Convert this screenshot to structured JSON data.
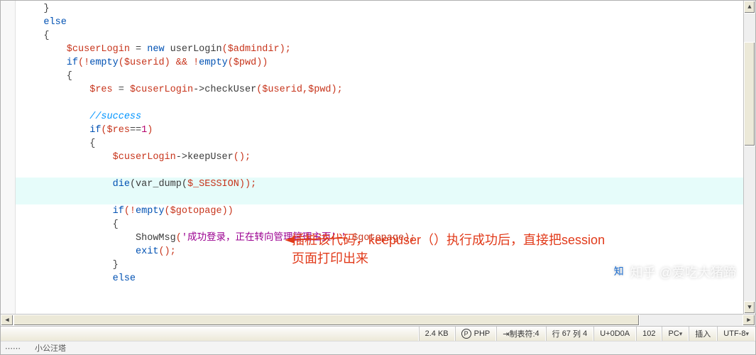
{
  "code": {
    "l01": "    }",
    "l02": "    else",
    "l03": "    {",
    "l04a": "        $cuserLogin",
    "l04b": " = ",
    "l04c": "new",
    "l04d": " userLogin",
    "l04e": "(",
    "l04f": "$admindir",
    "l04g": ");",
    "l05a": "        if",
    "l05b": "(!",
    "l05c": "empty",
    "l05d": "(",
    "l05e": "$userid",
    "l05f": ") && !",
    "l05g": "empty",
    "l05h": "(",
    "l05i": "$pwd",
    "l05j": "))",
    "l06": "        {",
    "l07a": "            $res",
    "l07b": " = ",
    "l07c": "$cuserLogin",
    "l07d": "->checkUser",
    "l07e": "(",
    "l07f": "$userid",
    "l07g": ",",
    "l07h": "$pwd",
    "l07i": ");",
    "l08": " ",
    "l09a": "            //success",
    "l10a": "            if",
    "l10b": "(",
    "l10c": "$res",
    "l10d": "==",
    "l10e": "1",
    "l10f": ")",
    "l11": "            {",
    "l12a": "                $cuserLogin",
    "l12b": "->keepUser",
    "l12c": "();",
    "l13": "                ",
    "l14a": "                die",
    "l14b": "(var_dump(",
    "l14c": "$_SESSION",
    "l14d": "));",
    "l15": "                ",
    "l16a": "                if",
    "l16b": "(!",
    "l16c": "empty",
    "l16d": "(",
    "l16e": "$gotopage",
    "l16f": "))",
    "l17": "                {",
    "l18a": "                    ShowMsg",
    "l18b": "(",
    "l18c": "'成功登录，正在转向管理管理主页！'",
    "l18d": ",",
    "l18e": "$gotopage",
    "l18f": ");",
    "l19a": "                    exit",
    "l19b": "();",
    "l20": "                }",
    "l21": "                else"
  },
  "annotation": {
    "line1": "插桩该代码，keepuser（）执行成功后，直接把session",
    "line2": "页面打印出来"
  },
  "status": {
    "size": "2.4 KB",
    "lang": "PHP",
    "tabstops_label": "制表符:",
    "tabstops": "4",
    "line_label": "行",
    "line": "67",
    "col_label": "列",
    "col": "4",
    "codepoint": "U+0D0A",
    "offset": "102",
    "encoding_mode": "PC",
    "insert_mode": "插入",
    "encoding": "UTF-8"
  },
  "extra": {
    "left": "⋯⋯",
    "right": "小公汪塔"
  },
  "watermark": "知乎 @爱吃大猪蹄"
}
